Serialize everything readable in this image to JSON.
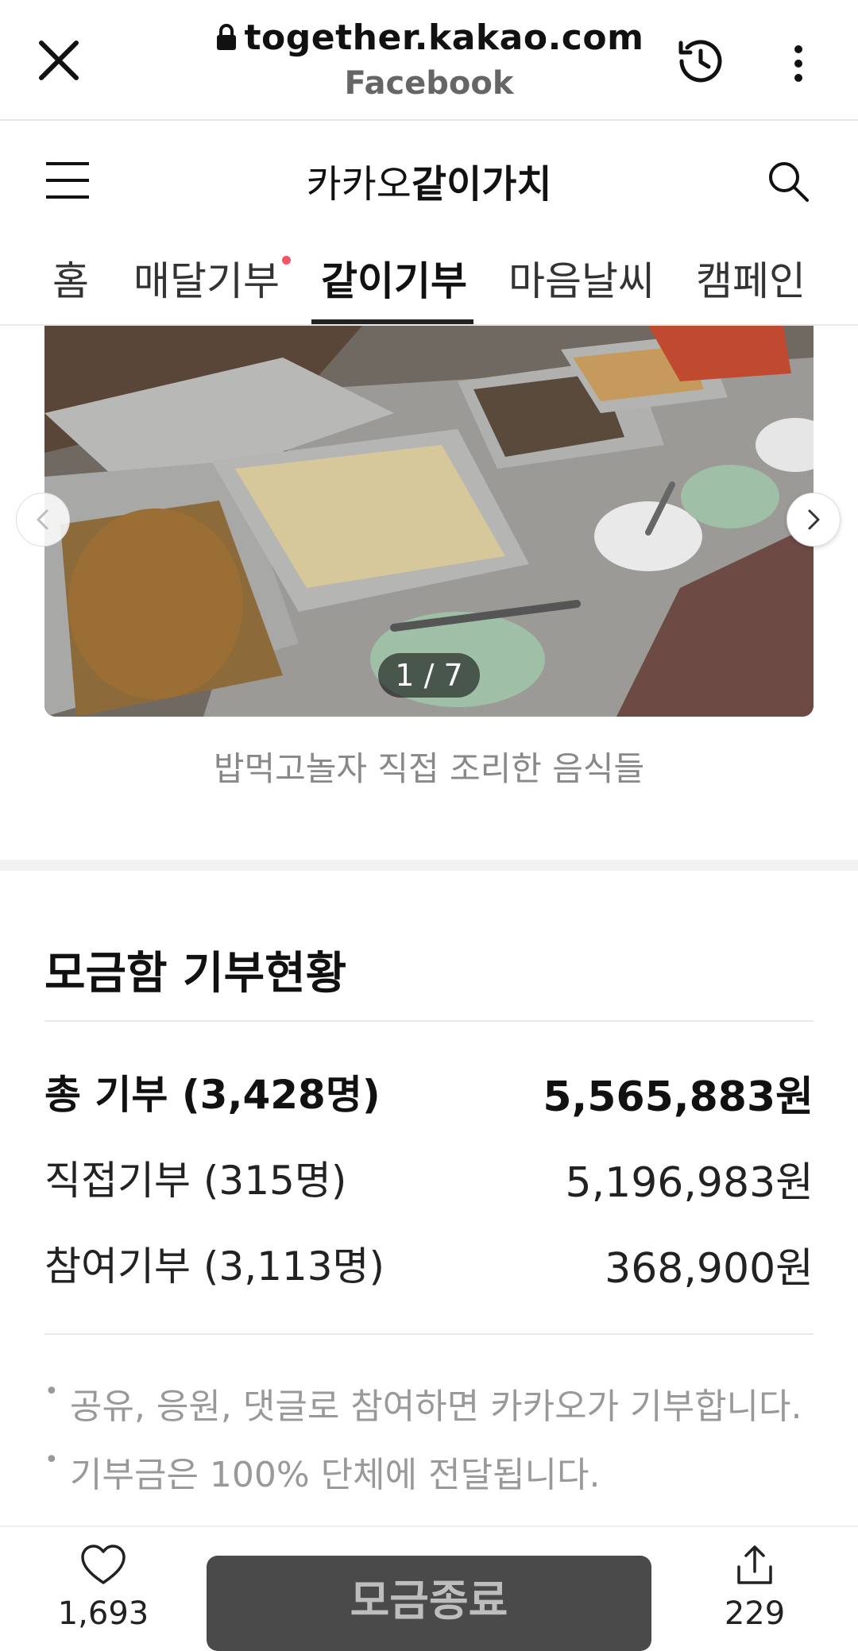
{
  "browser": {
    "url": "together.kakao.com",
    "source": "Facebook"
  },
  "site": {
    "logo_prefix": "카카오",
    "logo_main": "같이가치"
  },
  "tabs": [
    {
      "label": "홈"
    },
    {
      "label": "매달기부"
    },
    {
      "label": "같이기부"
    },
    {
      "label": "마음날씨"
    },
    {
      "label": "캠페인"
    }
  ],
  "active_tab": "같이기부",
  "gallery": {
    "counter": "1 / 7",
    "caption": "밥먹고놀자 직접 조리한 음식들"
  },
  "donation_status": {
    "title": "모금함 기부현황",
    "rows": [
      {
        "label": "총 기부 (3,428명)",
        "amount": "5,565,883원"
      },
      {
        "label": "직접기부 (315명)",
        "amount": "5,196,983원"
      },
      {
        "label": "참여기부 (3,113명)",
        "amount": "368,900원"
      }
    ],
    "notes": [
      "공유, 응원, 댓글로 참여하면 카카오가 기부합니다.",
      "기부금은 100% 단체에 전달됩니다."
    ]
  },
  "bottom_bar": {
    "like_count": "1,693",
    "action_label": "모금종료",
    "share_count": "229"
  },
  "colors": {
    "accent_dot": "#f0566a",
    "end_button": "#4a4a4a"
  }
}
